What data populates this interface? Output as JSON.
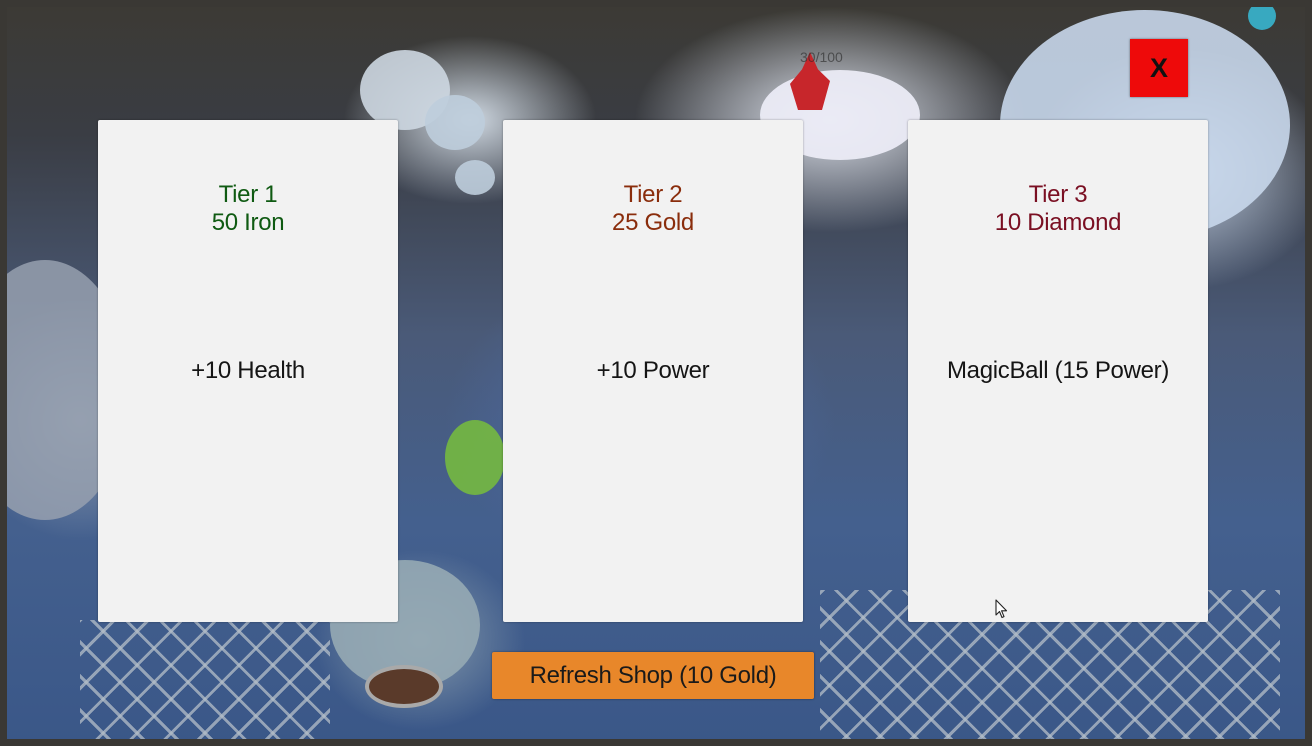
{
  "shop": {
    "cards": [
      {
        "tier_label": "Tier 1",
        "cost": "50 Iron",
        "reward": "+10 Health",
        "tier_color": "#0f5a12"
      },
      {
        "tier_label": "Tier 2",
        "cost": "25 Gold",
        "reward": "+10 Power",
        "tier_color": "#8a2d0c"
      },
      {
        "tier_label": "Tier 3",
        "cost": "10 Diamond",
        "reward": "MagicBall (15 Power)",
        "tier_color": "#7a0f22"
      }
    ],
    "close_label": "X",
    "refresh_label": "Refresh Shop (10 Gold)"
  },
  "background": {
    "counter_text": "30/100"
  },
  "colors": {
    "close_button": "#ee0a0a",
    "refresh_button": "#e8872a",
    "card_background": "#f2f2f2"
  }
}
